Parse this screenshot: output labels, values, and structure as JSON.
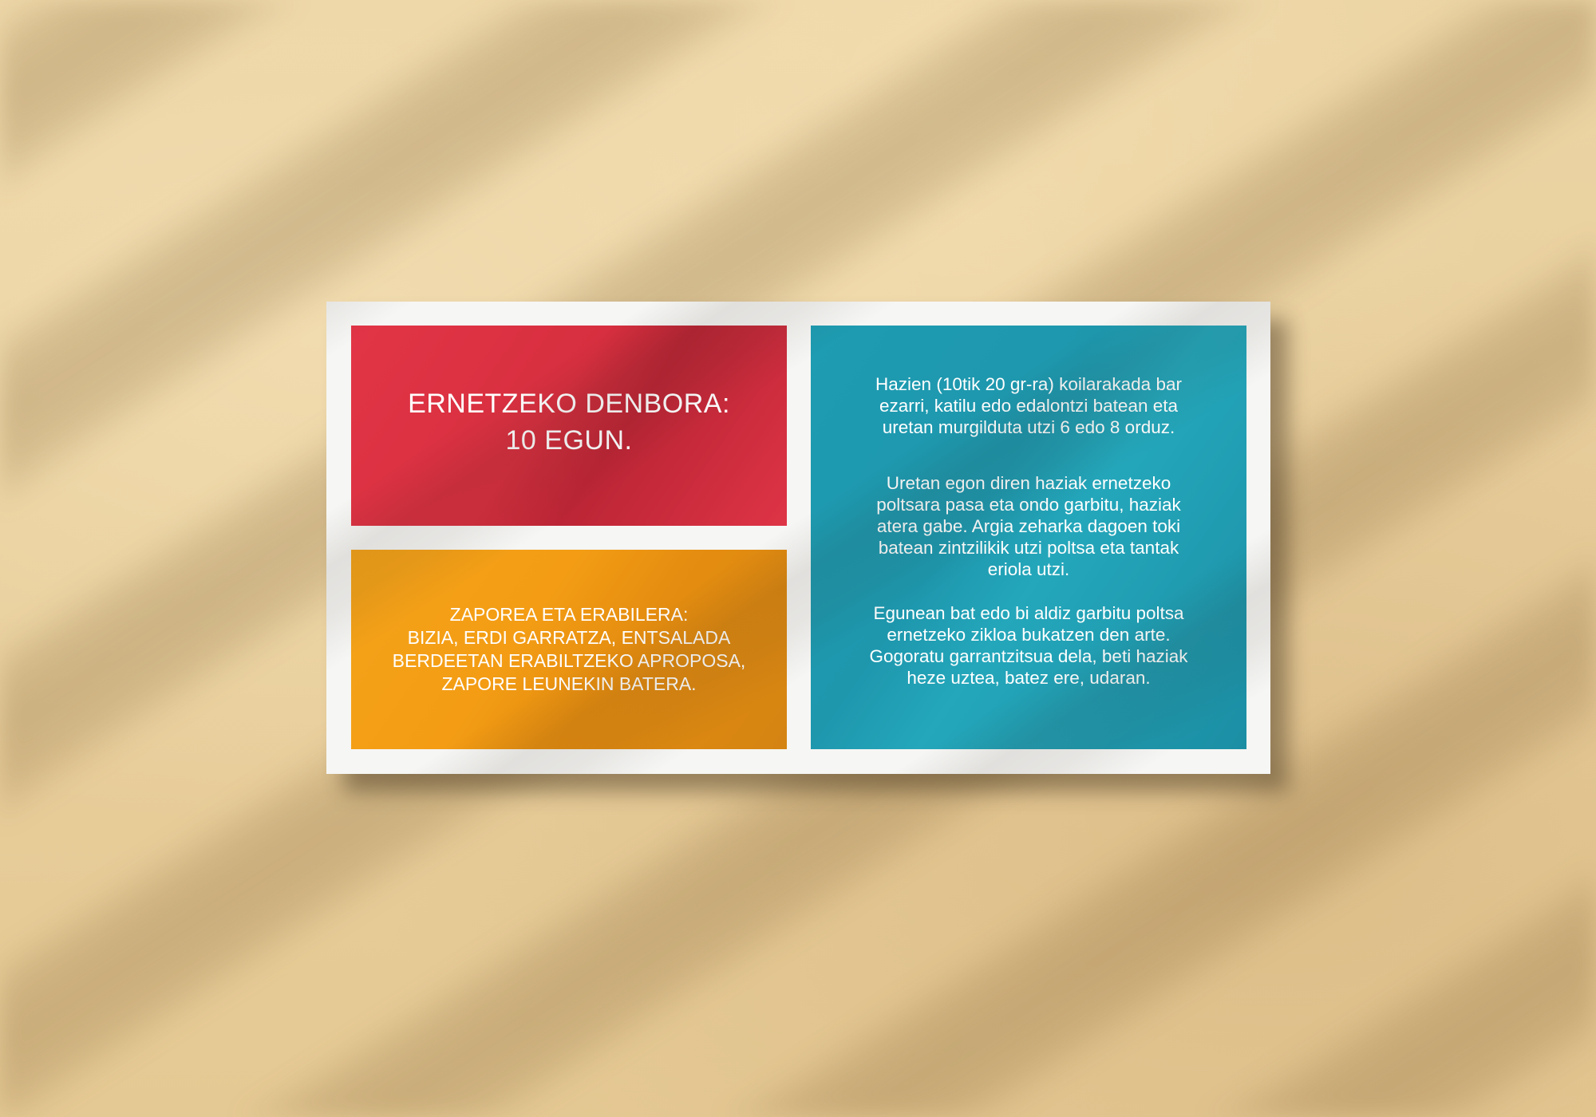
{
  "card": {
    "red_panel": {
      "text": "ERNETZEKO DENBORA:\n10 EGUN."
    },
    "orange_panel": {
      "text": "ZAPOREA ETA ERABILERA:\nBIZIA, ERDI GARRATZA, ENTSALADA\nBERDEETAN ERABILTZEKO APROPOSA,\nZAPORE LEUNEKIN BATERA."
    },
    "blue_panel": {
      "paragraph1": "Hazien (10tik 20 gr-ra) koilarakada bar\nezarri, katilu edo edalontzi batean eta\nuretan murgilduta utzi 6 edo 8 orduz.",
      "paragraph2": "Uretan egon diren haziak ernetzeko\npoltsara pasa eta ondo garbitu, haziak\natera gabe. Argia zeharka dagoen toki\nbatean zintzilikik utzi poltsa eta tantak\neriola utzi.",
      "paragraph3": "Egunean bat edo bi aldiz garbitu poltsa\nernetzeko zikloa bukatzen den arte.\nGogoratu garrantzitsua dela, beti haziak\nheze uztea, batez ere, udaran."
    }
  },
  "colors": {
    "background": "#e8cf9e",
    "card": "#f6f6f4",
    "red": "#e23546",
    "orange": "#f5a41a",
    "blue": "#1e9cb2",
    "text": "#ffffff"
  }
}
